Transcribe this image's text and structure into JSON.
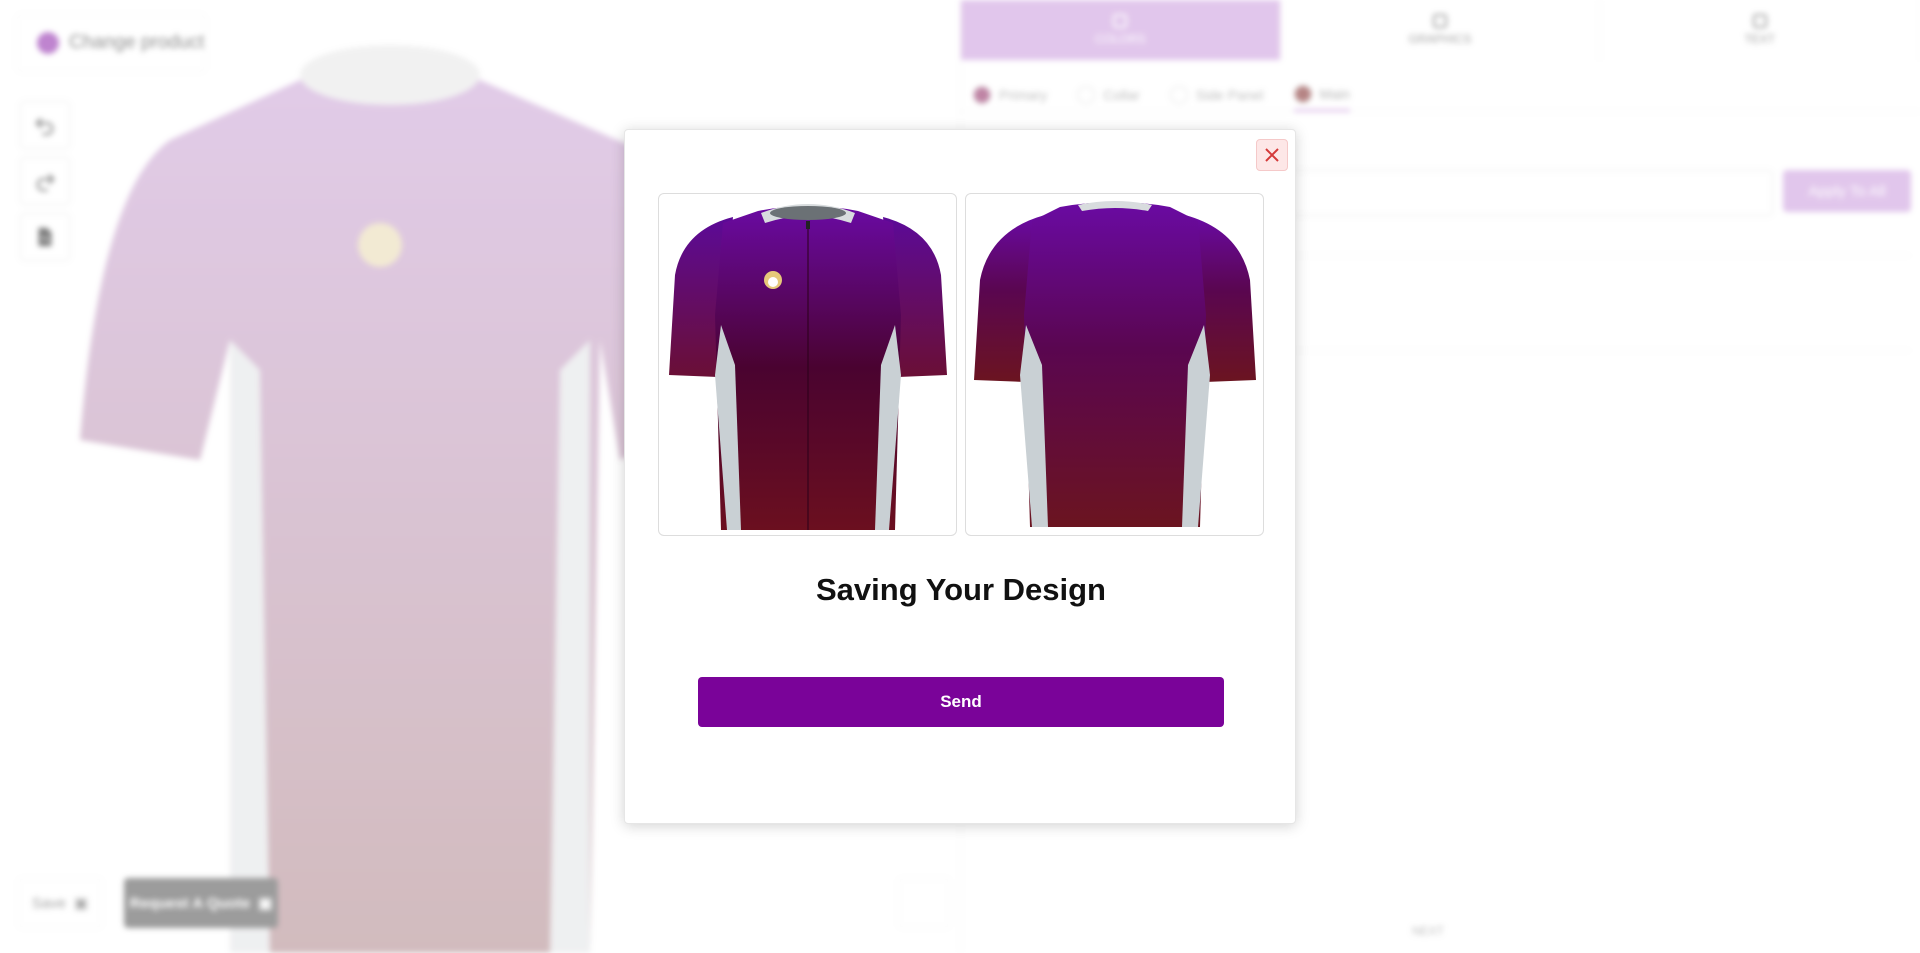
{
  "background": {
    "change_product_label": "Change product",
    "save_label": "Save",
    "request_quote_label": "Request A Quote",
    "top_tabs": [
      {
        "label": "COLORS",
        "active": true
      },
      {
        "label": "GRAPHICS",
        "active": false
      },
      {
        "label": "TEXT",
        "active": false
      }
    ],
    "color_tabs": [
      {
        "label": "Primary",
        "color": "#8a1f5a",
        "active": false
      },
      {
        "label": "Collar",
        "color": "#ffffff",
        "active": false
      },
      {
        "label": "Side Panel",
        "color": "#ffffff",
        "active": false
      },
      {
        "label": "Main",
        "color": "#7a2020",
        "active": true
      }
    ],
    "apply_all_label": "Apply To All",
    "next_label": "NEXT"
  },
  "modal": {
    "title": "Saving Your Design",
    "send_label": "Send",
    "front_image_icon": "jersey-front-image",
    "back_image_icon": "jersey-back-image"
  },
  "colors": {
    "accent": "#7a0399",
    "jersey_top": "#6a0aa3",
    "jersey_bottom": "#6b0f1f",
    "side_panel": "#c9d0d4",
    "collar": "#d8dcde"
  }
}
